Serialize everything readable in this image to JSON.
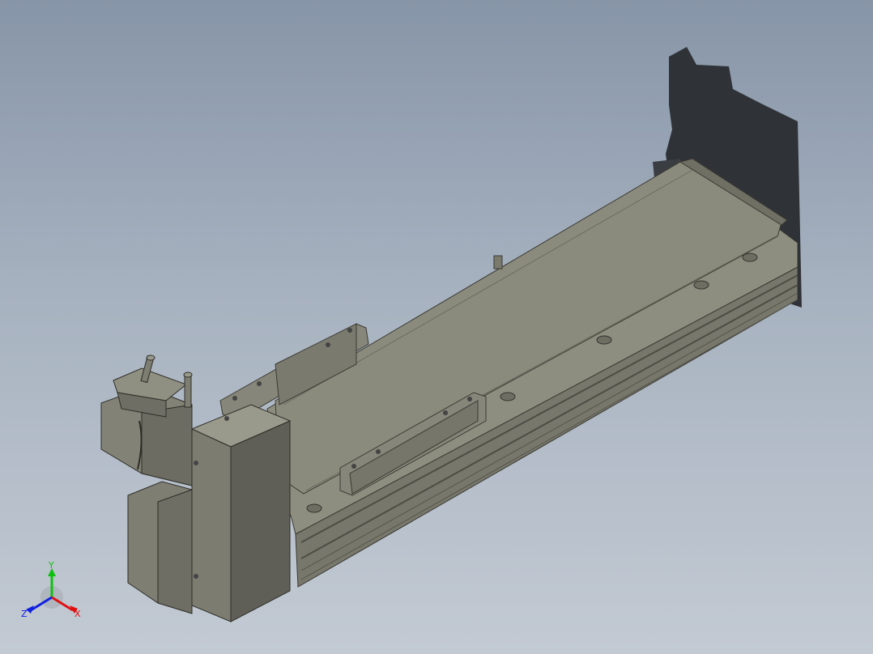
{
  "viewport": {
    "background_top": "#8795a8",
    "background_bottom": "#c3cad3",
    "model_color": "#8a8a7c",
    "model_dark": "#5e5e56",
    "shadow_color": "#2f3236"
  },
  "triad": {
    "x_label": "X",
    "y_label": "Y",
    "z_label": "Z",
    "x_color": "#e01010",
    "y_color": "#10c010",
    "z_color": "#1020e0"
  }
}
